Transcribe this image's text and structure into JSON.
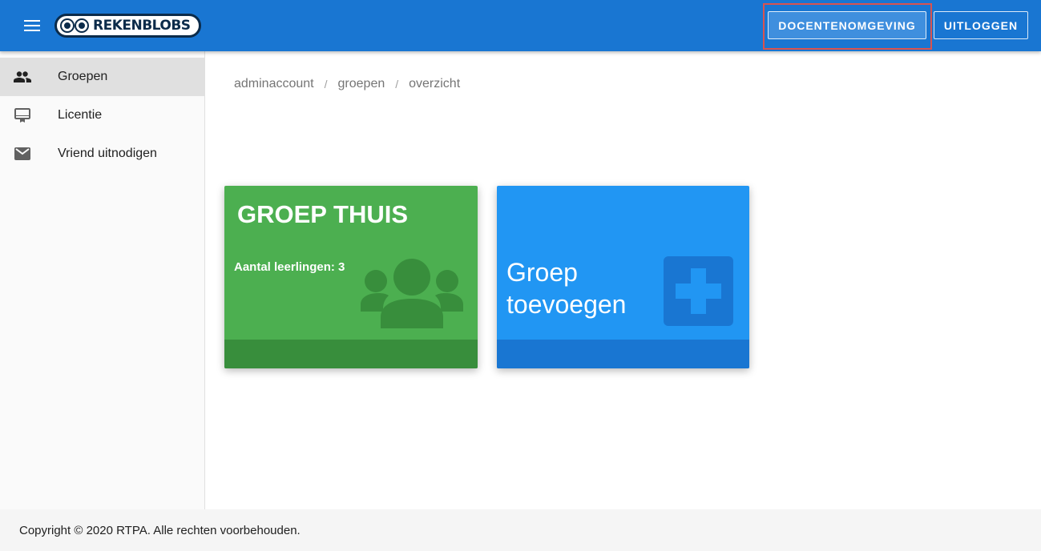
{
  "header": {
    "logo_text": "REKENBLOBS",
    "teacher_button": "DOCENTENOMGEVING",
    "logout_button": "UITLOGGEN",
    "menu_icon": "menu-icon"
  },
  "sidebar": {
    "items": [
      {
        "label": "Groepen",
        "icon": "group-icon",
        "active": true
      },
      {
        "label": "Licentie",
        "icon": "card-membership-icon",
        "active": false
      },
      {
        "label": "Vriend uitnodigen",
        "icon": "mail-icon",
        "active": false
      }
    ]
  },
  "breadcrumb": [
    "adminaccount",
    "groepen",
    "overzicht"
  ],
  "breadcrumb_separator": "/",
  "cards": {
    "group": {
      "title": "GROEP THUIS",
      "subtitle": "Aantal leerlingen: 3",
      "icon": "group-icon"
    },
    "add": {
      "title": "Groep toevoegen",
      "icon": "plus-icon"
    }
  },
  "footer": {
    "copyright": "Copyright © 2020 RTPA. Alle rechten voorbehouden."
  },
  "colors": {
    "primary": "#1976d2",
    "green": "#4caf50",
    "green_dark": "#388e3c",
    "blue": "#2196f3",
    "highlight": "#d9534f"
  }
}
